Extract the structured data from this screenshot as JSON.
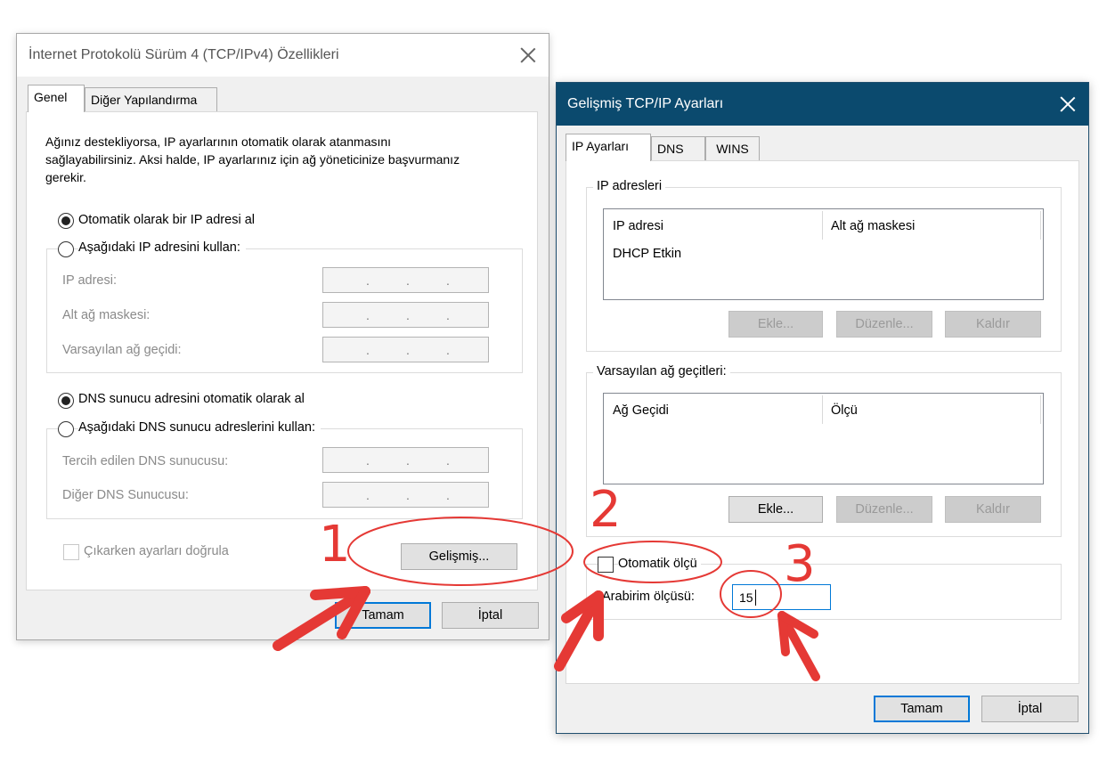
{
  "win1": {
    "title": "İnternet Protokolü Sürüm 4 (TCP/IPv4) Özellikleri",
    "tabs": [
      "Genel",
      "Diğer Yapılandırma"
    ],
    "intro": [
      "Ağınız destekliyorsa, IP ayarlarının otomatik olarak atanmasını",
      "sağlayabilirsiniz. Aksi halde, IP ayarlarınız için ağ yöneticinize başvurmanız",
      "gerekir."
    ],
    "radio_auto_ip": "Otomatik olarak bir IP adresi al",
    "radio_manual_ip": "Aşağıdaki IP adresini kullan:",
    "ip_label": "IP adresi:",
    "mask_label": "Alt ağ maskesi:",
    "gateway_label": "Varsayılan ağ geçidi:",
    "radio_auto_dns": "DNS sunucu adresini otomatik olarak al",
    "radio_manual_dns": "Aşağıdaki DNS sunucu adreslerini kullan:",
    "pref_dns_label": "Tercih edilen DNS sunucusu:",
    "alt_dns_label": "Diğer DNS Sunucusu:",
    "validate_label": "Çıkarken ayarları doğrula",
    "advanced_button": "Gelişmiş...",
    "ok_button": "Tamam",
    "cancel_button": "İptal"
  },
  "win2": {
    "title": "Gelişmiş TCP/IP Ayarları",
    "tabs": [
      "IP Ayarları",
      "DNS",
      "WINS"
    ],
    "ip_group": "IP adresleri",
    "ip_col1": "IP adresi",
    "ip_col2": "Alt ağ maskesi",
    "ip_row": "DHCP Etkin",
    "gw_group": "Varsayılan ağ geçitleri:",
    "gw_col1": "Ağ Geçidi",
    "gw_col2": "Ölçü",
    "add_button": "Ekle...",
    "edit_button": "Düzenle...",
    "remove_button": "Kaldır",
    "auto_metric_label": "Otomatik ölçü",
    "interface_metric_label": "Arabirim ölçüsü:",
    "interface_metric_value": "15",
    "ok_button": "Tamam",
    "cancel_button": "İptal"
  },
  "annotations": {
    "step1": "1",
    "step2": "2",
    "step3": "3",
    "color": "#e53935"
  }
}
